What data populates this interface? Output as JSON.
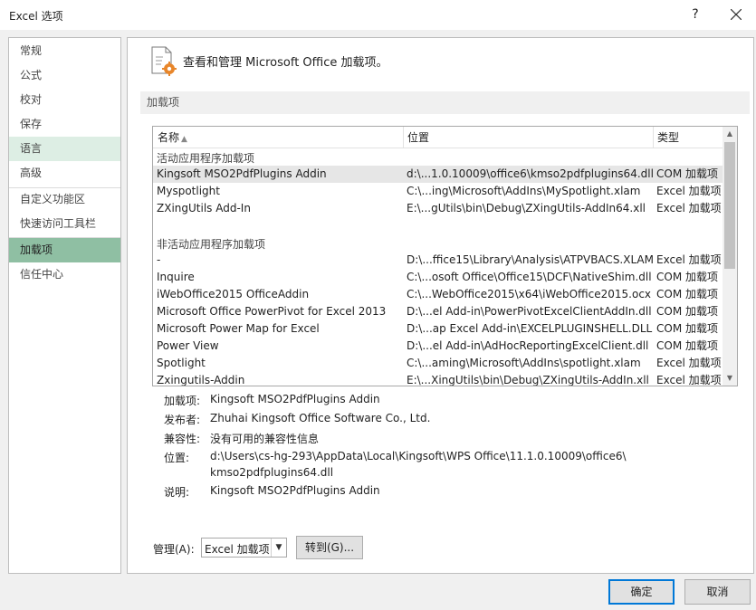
{
  "window": {
    "title": "Excel 选项",
    "help": "?"
  },
  "sidebar": {
    "items": [
      {
        "label": "常规"
      },
      {
        "label": "公式"
      },
      {
        "label": "校对"
      },
      {
        "label": "保存"
      },
      {
        "label": "语言"
      },
      {
        "label": "高级"
      },
      {
        "label": "自定义功能区"
      },
      {
        "label": "快速访问工具栏"
      },
      {
        "label": "加载项"
      },
      {
        "label": "信任中心"
      }
    ],
    "selected": "加载项"
  },
  "main": {
    "header": "查看和管理 Microsoft Office 加载项。",
    "section_title": "加载项",
    "columns": {
      "name": "名称",
      "location": "位置",
      "type": "类型"
    },
    "active_group": "活动应用程序加载项",
    "active_rows": [
      {
        "name": "Kingsoft MSO2PdfPlugins Addin",
        "location": "d:\\...1.0.10009\\office6\\kmso2pdfplugins64.dll",
        "type": "COM 加载项"
      },
      {
        "name": "Myspotlight",
        "location": "C:\\...ing\\Microsoft\\AddIns\\MySpotlight.xlam",
        "type": "Excel 加载项"
      },
      {
        "name": "ZXingUtils Add-In",
        "location": "E:\\...gUtils\\bin\\Debug\\ZXingUtils-AddIn64.xll",
        "type": "Excel 加载项"
      }
    ],
    "inactive_group": "非活动应用程序加载项",
    "inactive_rows": [
      {
        "name": "-",
        "location": "D:\\...ffice15\\Library\\Analysis\\ATPVBACS.XLAM",
        "type": "Excel 加载项"
      },
      {
        "name": "Inquire",
        "location": "C:\\...osoft Office\\Office15\\DCF\\NativeShim.dll",
        "type": "COM 加载项"
      },
      {
        "name": "iWebOffice2015 OfficeAddin",
        "location": "C:\\...WebOffice2015\\x64\\iWebOffice2015.ocx",
        "type": "COM 加载项"
      },
      {
        "name": "Microsoft Office PowerPivot for Excel 2013",
        "location": "D:\\...el Add-in\\PowerPivotExcelClientAddIn.dll",
        "type": "COM 加载项"
      },
      {
        "name": "Microsoft Power Map for Excel",
        "location": "D:\\...ap Excel Add-in\\EXCELPLUGINSHELL.DLL",
        "type": "COM 加载项"
      },
      {
        "name": "Power View",
        "location": "D:\\...el Add-in\\AdHocReportingExcelClient.dll",
        "type": "COM 加载项"
      },
      {
        "name": "Spotlight",
        "location": "C:\\...aming\\Microsoft\\AddIns\\spotlight.xlam",
        "type": "Excel 加载项"
      },
      {
        "name": "Zxingutils-Addin",
        "location": "E:\\...XingUtils\\bin\\Debug\\ZXingUtils-AddIn.xll",
        "type": "Excel 加载项"
      }
    ],
    "details": {
      "addin_label": "加载项:",
      "addin_value": "Kingsoft MSO2PdfPlugins Addin",
      "publisher_label": "发布者:",
      "publisher_value": "Zhuhai Kingsoft Office Software Co., Ltd.",
      "compat_label": "兼容性:",
      "compat_value": "没有可用的兼容性信息",
      "location_label": "位置:",
      "location_value_1": "d:\\Users\\cs-hg-293\\AppData\\Local\\Kingsoft\\WPS Office\\11.1.0.10009\\office6\\",
      "location_value_2": "kmso2pdfplugins64.dll",
      "desc_label": "说明:",
      "desc_value": "Kingsoft MSO2PdfPlugins Addin"
    },
    "manage": {
      "label": "管理(A):",
      "selected": "Excel 加载项",
      "go_label": "转到(G)..."
    }
  },
  "footer": {
    "ok_label": "确定",
    "cancel_label": "取消"
  },
  "colors": {
    "accent": "#0078d7",
    "nav_selected": "#8fbfa3",
    "nav_hover": "#ddeee4",
    "icon_orange": "#e8862a"
  }
}
